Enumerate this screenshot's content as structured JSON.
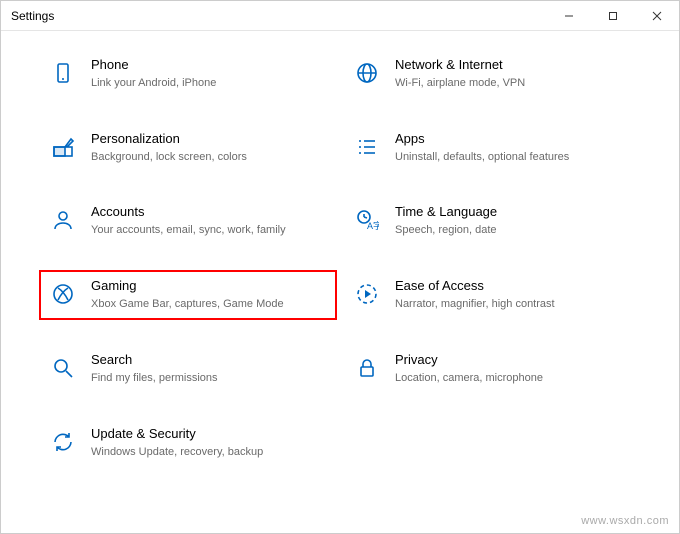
{
  "window": {
    "title": "Settings"
  },
  "tiles": [
    {
      "id": "phone",
      "title": "Phone",
      "desc": "Link your Android, iPhone"
    },
    {
      "id": "network",
      "title": "Network & Internet",
      "desc": "Wi-Fi, airplane mode, VPN"
    },
    {
      "id": "personal",
      "title": "Personalization",
      "desc": "Background, lock screen, colors"
    },
    {
      "id": "apps",
      "title": "Apps",
      "desc": "Uninstall, defaults, optional features"
    },
    {
      "id": "accounts",
      "title": "Accounts",
      "desc": "Your accounts, email, sync, work, family"
    },
    {
      "id": "time",
      "title": "Time & Language",
      "desc": "Speech, region, date"
    },
    {
      "id": "gaming",
      "title": "Gaming",
      "desc": "Xbox Game Bar, captures, Game Mode"
    },
    {
      "id": "ease",
      "title": "Ease of Access",
      "desc": "Narrator, magnifier, high contrast"
    },
    {
      "id": "search",
      "title": "Search",
      "desc": "Find my files, permissions"
    },
    {
      "id": "privacy",
      "title": "Privacy",
      "desc": "Location, camera, microphone"
    },
    {
      "id": "update",
      "title": "Update & Security",
      "desc": "Windows Update, recovery, backup"
    }
  ],
  "highlighted": "gaming",
  "watermark": "www.wsxdn.com"
}
